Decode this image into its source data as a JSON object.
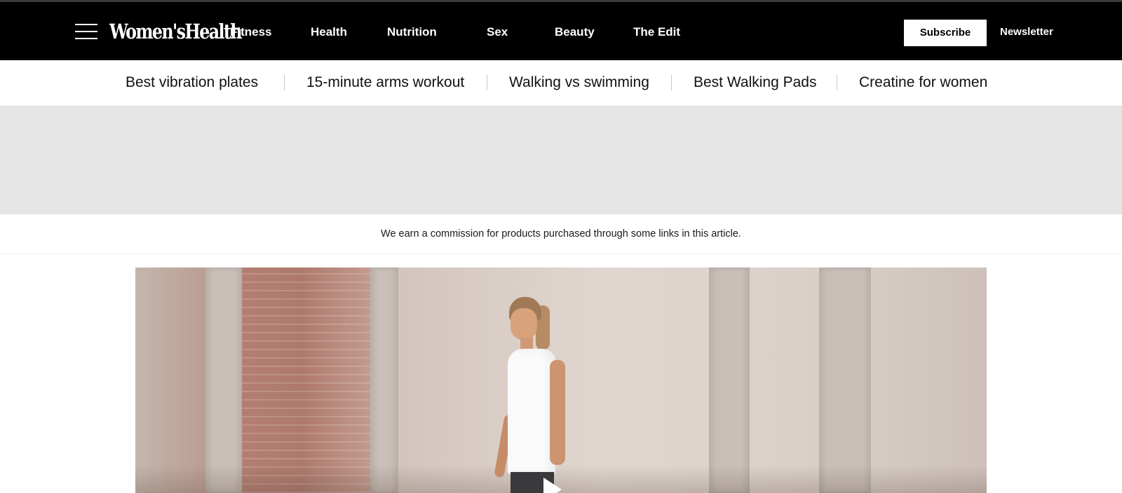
{
  "header": {
    "logo_text": "Women'sHealth",
    "nav": [
      {
        "label": "Fitness"
      },
      {
        "label": "Health"
      },
      {
        "label": "Nutrition"
      },
      {
        "label": "Sex"
      },
      {
        "label": "Beauty"
      },
      {
        "label": "The Edit"
      }
    ],
    "subscribe_label": "Subscribe",
    "newsletter_label": "Newsletter",
    "icons": {
      "menu": "hamburger-menu-icon"
    }
  },
  "trending": [
    {
      "label": "Best vibration plates"
    },
    {
      "label": "15-minute arms workout"
    },
    {
      "label": "Walking vs swimming"
    },
    {
      "label": "Best Walking Pads"
    },
    {
      "label": "Creatine for women"
    }
  ],
  "disclosure": {
    "text": "We earn a commission for products purchased through some links in this article."
  },
  "hero": {
    "icons": {
      "play": "play-icon"
    }
  },
  "colors": {
    "header_bg": "#000000",
    "ad_slot_bg": "#e5e5e5",
    "text_dark": "#111111"
  }
}
